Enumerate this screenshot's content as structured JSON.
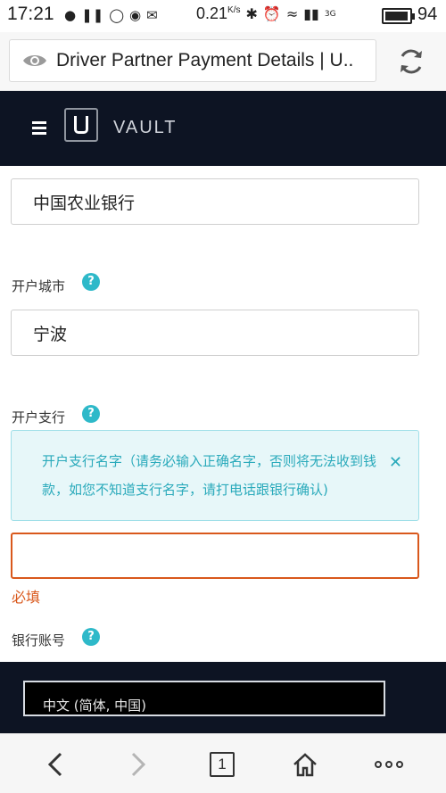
{
  "status_bar": {
    "time": "17:21",
    "speed": "0.21",
    "speed_unit": "K/s",
    "network": "3G",
    "battery": "94"
  },
  "browser": {
    "page_title": "Driver Partner Payment Details | U.."
  },
  "app": {
    "title": "VAULT"
  },
  "form": {
    "bank_name_value": "中国农业银行",
    "city_label": "开户城市",
    "city_value": "宁波",
    "branch_label": "开户支行",
    "branch_info": "开户支行名字（请务必输入正确名字，否则将无法收到钱款，如您不知道支行名字，请打电话跟银行确认)",
    "branch_value": "",
    "required_text": "必填",
    "account_label": "银行账号",
    "help_glyph": "?"
  },
  "language": {
    "selected": "中文 (简体, 中国)"
  },
  "bottom_nav": {
    "tab_count": "1"
  },
  "colors": {
    "header_bg": "#0d1423",
    "accent": "#2eb9c9",
    "error": "#d9581c"
  }
}
